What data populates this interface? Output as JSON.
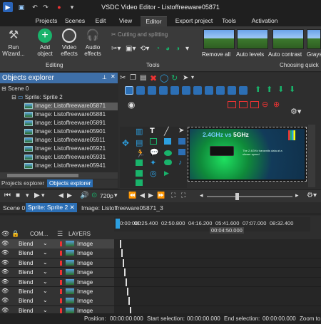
{
  "app": {
    "title": "VSDC Video Editor - Listoffreeware05871"
  },
  "menu": {
    "items": [
      "Projects",
      "Scenes",
      "Edit",
      "View",
      "Editor",
      "Export project",
      "Tools",
      "Activation"
    ],
    "active": "Editor"
  },
  "ribbon": {
    "run_wizard": "Run\nWizard...",
    "add_object": "Add\nobject",
    "video_effects": "Video\neffects",
    "audio_effects": "Audio\neffects",
    "editing_label": "Editing",
    "cutting_splitting": "Cutting and splitting",
    "tools_label": "Tools",
    "quick": [
      "Remove all",
      "Auto levels",
      "Auto contrast",
      "Grays"
    ],
    "choosing_quick": "Choosing quick"
  },
  "objects_explorer": {
    "title": "Objects explorer",
    "scene": "Scene 0",
    "sprite": "Sprite: Sprite 2",
    "images": [
      "Image: Listoffreeware05871",
      "Image: Listoffreeware05881",
      "Image: Listoffreeware05891",
      "Image: Listoffreeware05901",
      "Image: Listoffreeware05911",
      "Image: Listoffreeware05921",
      "Image: Listoffreeware05931",
      "Image: Listoffreeware05941"
    ],
    "tabs": [
      "Projects explorer",
      "Objects explorer"
    ]
  },
  "preview": {
    "headline_a": "2.4GHz vs ",
    "headline_b": "5GHz",
    "body": "The 2.4GHz transmits data at a slower speed",
    "quality": "720p"
  },
  "doc_tabs": [
    "Scene 0",
    "Sprite: Sprite 2",
    "Image: Listoffreeware05871_3"
  ],
  "timeline": {
    "com_label": "COM...",
    "layers_label": "LAYERS",
    "ruler": [
      "00:00:000",
      "01:25.400",
      "02:50.800",
      "04:16.200",
      "05:41.600",
      "07:07.000",
      "08:32.400"
    ],
    "marker": "00:04:50.000",
    "rows": [
      {
        "blend": "Blend",
        "name": "Image"
      },
      {
        "blend": "Blend",
        "name": "Image"
      },
      {
        "blend": "Blend",
        "name": "Image"
      },
      {
        "blend": "Blend",
        "name": "Image"
      },
      {
        "blend": "Blend",
        "name": "Image"
      },
      {
        "blend": "Blend",
        "name": "Image"
      },
      {
        "blend": "Blend",
        "name": "Image"
      },
      {
        "blend": "Blend",
        "name": "Image"
      }
    ]
  },
  "status": {
    "position_label": "Position:",
    "position": "00:00:00.000",
    "start_label": "Start selection:",
    "start": "00:00:00.000",
    "end_label": "End selection:",
    "end": "00:00:00.000",
    "zoom_label": "Zoom to"
  },
  "colors": {
    "accent": "#3e6fa8",
    "active_tab": "#2c6fb5",
    "green": "#19b36b"
  }
}
